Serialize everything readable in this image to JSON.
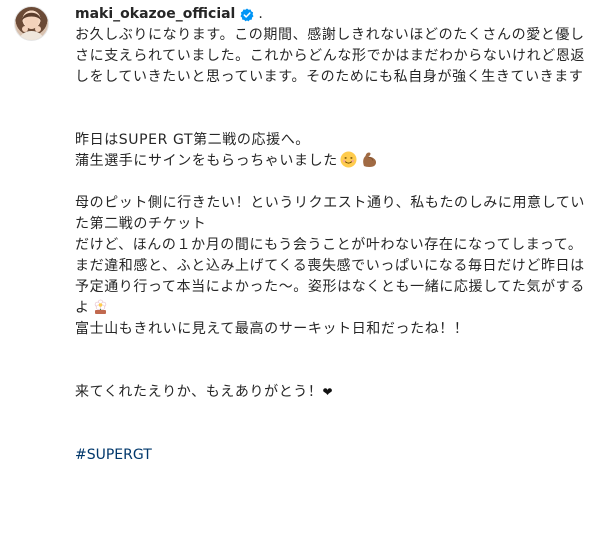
{
  "post": {
    "username": "maki_okazoe_official",
    "separator": ".",
    "paragraphs": [
      "お久しぶりになります。この期間、感謝しきれないほどのたくさんの愛と優しさに支えられていました。これからどんな形でかはまだわからないけれど恩返しをしていきたいと思っています。そのためにも私自身が強く生きていきます",
      "昨日はSUPER GT第二戦の応援へ。",
      "蒲生選手にサインをもらっちゃいました",
      "母のピット側に行きたい！というリクエスト通り、私もたのしみに用意していた第二戦のチケット",
      "だけど、ほんの１か月の間にもう会うことが叶わない存在になってしまって。",
      "まだ違和感と、ふと込み上げてくる喪失感でいっぱいになる毎日だけど昨日は予定通り行って本当によかった〜。姿形はなくとも一緒に応援してた気がするよ",
      "富士山もきれいに見えて最高のサーキット日和だったね！！",
      "来てくれたえりか、もえありがとう！"
    ],
    "heart_glyph": "❤",
    "hashtag": "#SUPERGT",
    "icons": {
      "avatar": "profile-photo",
      "verified": "verified-badge-icon",
      "emoji_1": "smiling-face-emoji",
      "emoji_2": "flexed-biceps-emoji",
      "emoji_3": "blossom-emoji"
    },
    "colors": {
      "text": "#262626",
      "verified": "#0095f6",
      "hashtag": "#00376b"
    }
  }
}
